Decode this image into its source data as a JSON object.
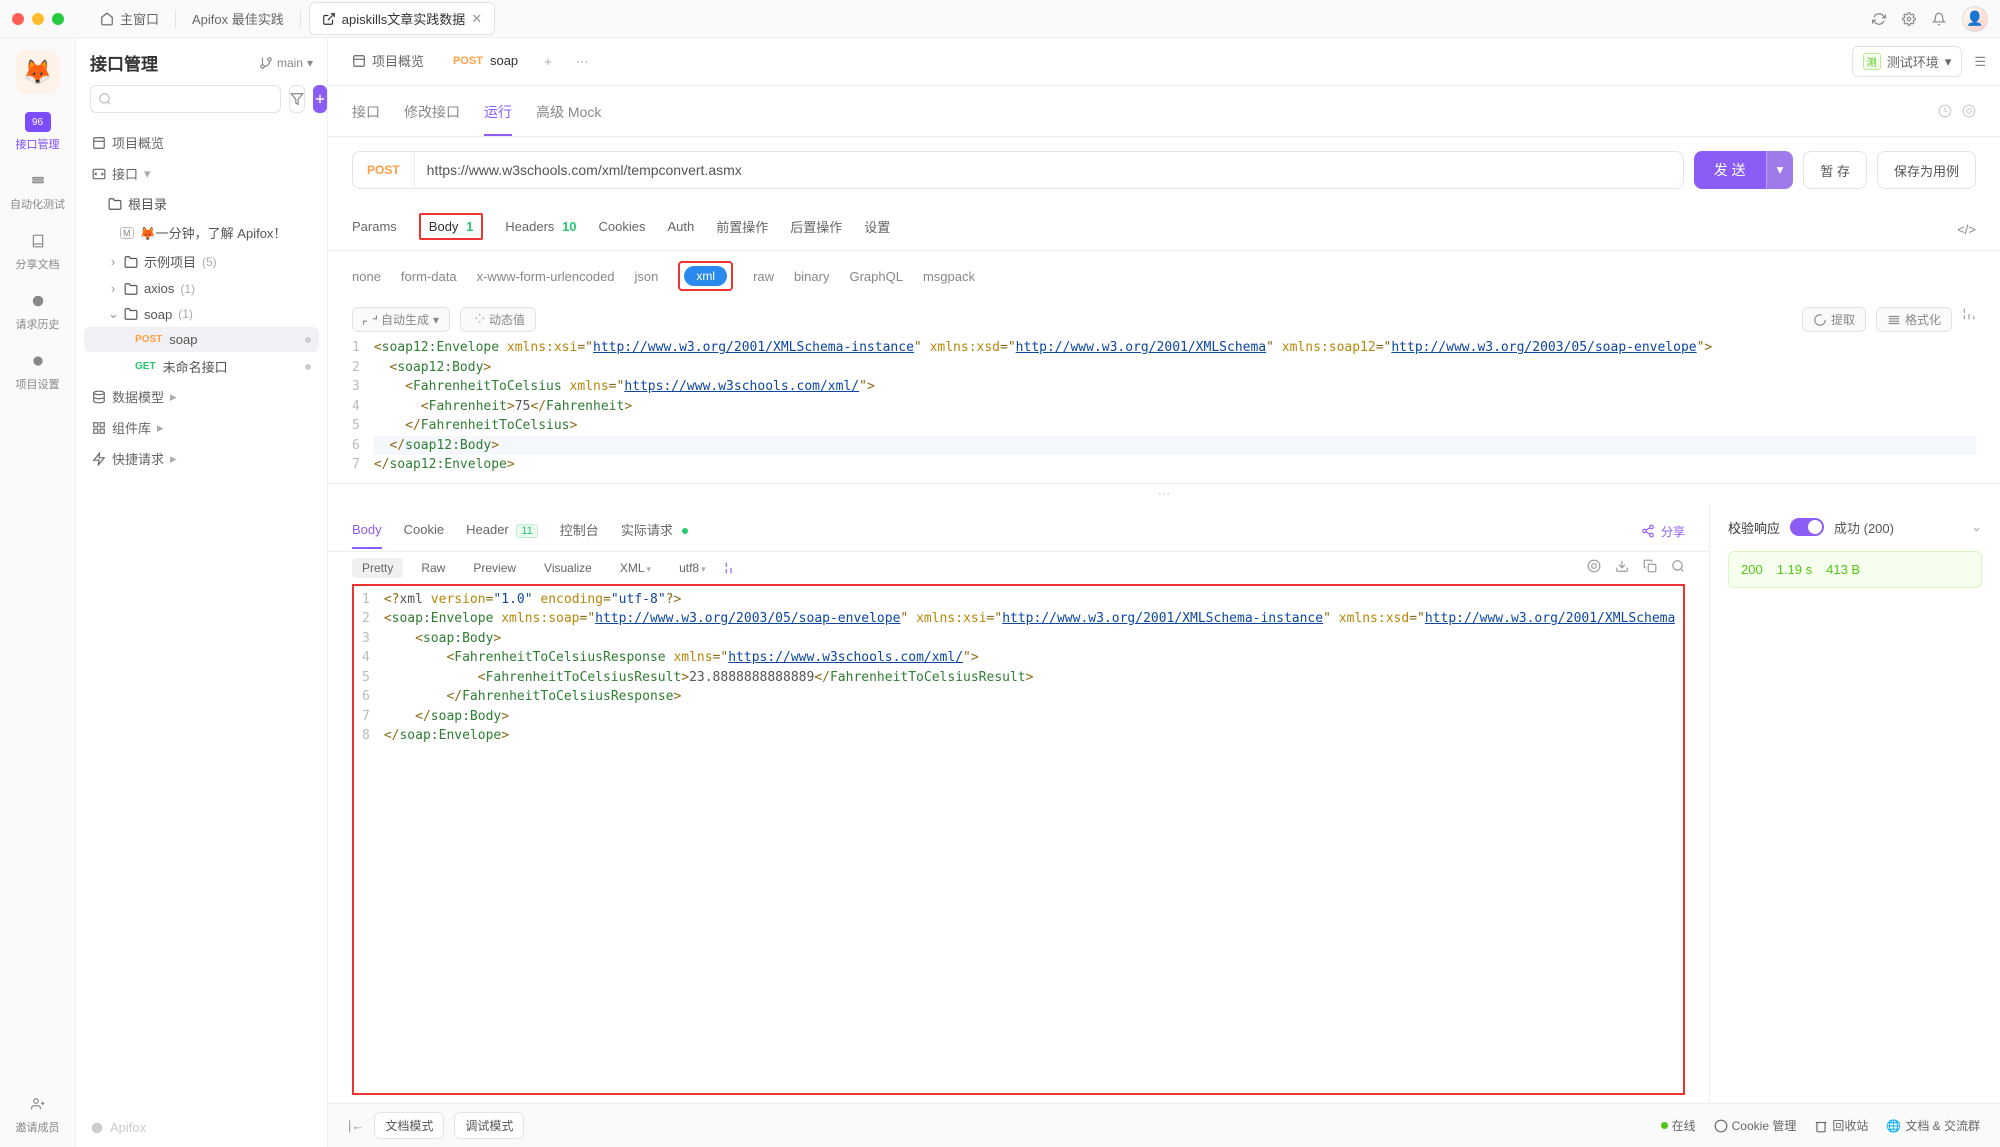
{
  "titlebar": {
    "main_window": "主窗口",
    "tab1": "Apifox 最佳实践",
    "tab2": "apiskills文章实践数据"
  },
  "rail": {
    "items": [
      "接口管理",
      "自动化测试",
      "分享文档",
      "请求历史",
      "项目设置"
    ],
    "invite": "邀请成员"
  },
  "sidebar": {
    "title": "接口管理",
    "branch": "main",
    "overview": "项目概览",
    "api_root": "接口",
    "root_folder": "根目录",
    "md_item": "🦊一分钟，了解 Apifox！",
    "folder1": {
      "name": "示例项目",
      "count": "(5)"
    },
    "folder2": {
      "name": "axios",
      "count": "(1)"
    },
    "folder3": {
      "name": "soap",
      "count": "(1)"
    },
    "api1": {
      "method": "POST",
      "name": "soap"
    },
    "api2": {
      "method": "GET",
      "name": "未命名接口"
    },
    "data_model": "数据模型",
    "components": "组件库",
    "quick_req": "快捷请求",
    "footer_brand": "Apifox"
  },
  "tabs": {
    "tab_overview": "项目概览",
    "tab_api": {
      "method": "POST",
      "name": "soap"
    },
    "env": "测试环境"
  },
  "subtabs": [
    "接口",
    "修改接口",
    "运行",
    "高级 Mock"
  ],
  "url": {
    "method": "POST",
    "value": "https://www.w3schools.com/xml/tempconvert.asmx"
  },
  "buttons": {
    "send": "发 送",
    "save_temp": "暂 存",
    "save_case": "保存为用例"
  },
  "reqtabs": {
    "params": "Params",
    "body": "Body",
    "body_count": "1",
    "headers": "Headers",
    "headers_count": "10",
    "cookies": "Cookies",
    "auth": "Auth",
    "pre": "前置操作",
    "post": "后置操作",
    "settings": "设置"
  },
  "bodytypes": [
    "none",
    "form-data",
    "x-www-form-urlencoded",
    "json",
    "xml",
    "raw",
    "binary",
    "GraphQL",
    "msgpack"
  ],
  "bodytools": {
    "auto_gen": "自动生成",
    "dynamic": "动态值",
    "extract": "提取",
    "format": "格式化"
  },
  "request_body": {
    "urls": {
      "xsi": "http://www.w3.org/2001/XMLSchema-instance",
      "xsd": "http://www.w3.org/2001/XMLSchema",
      "soap12": "http://www.w3.org/2003/05/soap-envelope",
      "xmlns": "https://www.w3schools.com/xml/"
    },
    "fahrenheit_value": "75"
  },
  "resptabs": {
    "body": "Body",
    "cookie": "Cookie",
    "header": "Header",
    "header_count": "11",
    "console": "控制台",
    "actual": "实际请求",
    "share": "分享"
  },
  "resptools": {
    "views": [
      "Pretty",
      "Raw",
      "Preview",
      "Visualize"
    ],
    "format": "XML",
    "encoding": "utf8"
  },
  "response_body": {
    "xml_decl": {
      "version": "1.0",
      "encoding": "utf-8"
    },
    "urls": {
      "soap": "http://www.w3.org/2003/05/soap-envelope",
      "xsi": "http://www.w3.org/2001/XMLSchema-instance",
      "xsd": "http://www.w3.org/2001/XMLSchema",
      "xmlns": "https://www.w3schools.com/xml/"
    },
    "result": "23.8888888888889"
  },
  "respside": {
    "validate": "校验响应",
    "success": "成功 (200)"
  },
  "status": {
    "code": "200",
    "time": "1.19 s",
    "size": "413 B"
  },
  "bottombar": {
    "doc_mode": "文档模式",
    "debug_mode": "调试模式",
    "online": "在线",
    "cookie": "Cookie 管理",
    "trash": "回收站",
    "community": "文档 & 交流群"
  }
}
